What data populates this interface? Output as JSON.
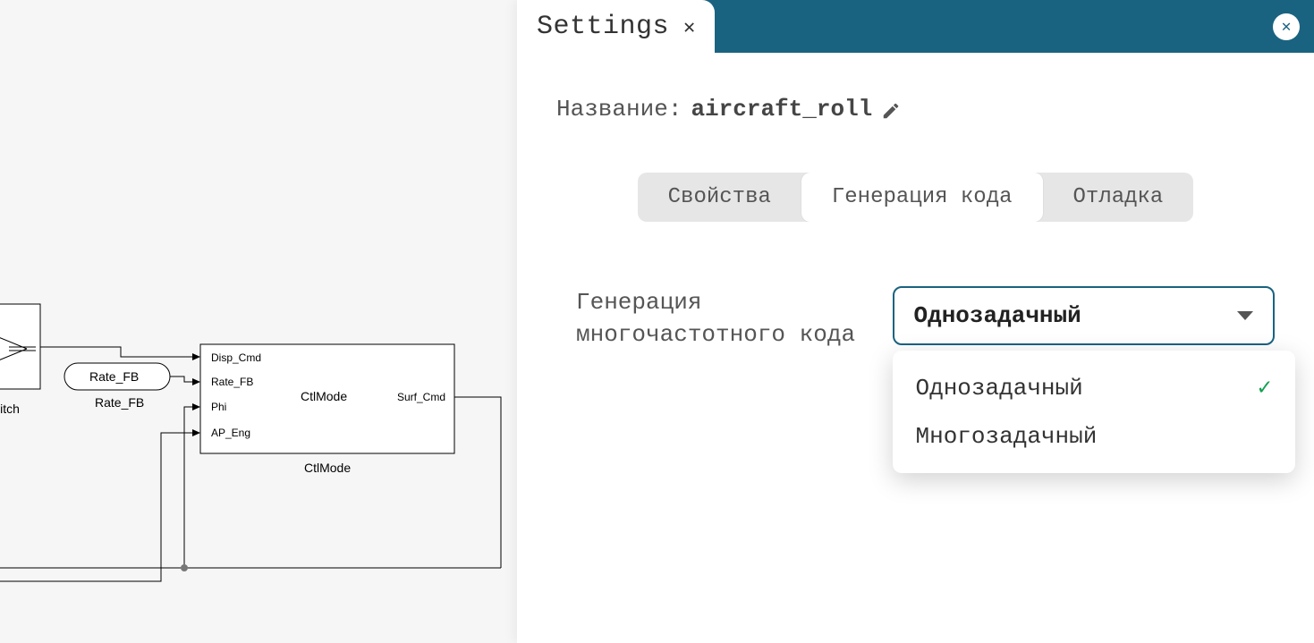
{
  "panel": {
    "title": "Settings",
    "name_label": "Название:",
    "name_value": "aircraft_roll",
    "tabs": [
      {
        "label": "Свойства",
        "active": false
      },
      {
        "label": "Генерация кода",
        "active": true
      },
      {
        "label": "Отладка",
        "active": false
      }
    ],
    "field": {
      "label_lines": [
        "Генерация",
        "многочастотного кода"
      ],
      "selected": "Однозадачный",
      "options": [
        {
          "label": "Однозадачный",
          "selected": true
        },
        {
          "label": "Многозадачный",
          "selected": false
        }
      ]
    }
  },
  "diagram": {
    "switch_block": {
      "name": "witch"
    },
    "rate_fb_source": {
      "label": "Rate_FB",
      "caption": "Rate_FB"
    },
    "ctlmode_block": {
      "name": "CtlMode",
      "caption": "CtlMode",
      "inputs": [
        "Disp_Cmd",
        "Rate_FB",
        "Phi",
        "AP_Eng"
      ],
      "outputs": [
        "Surf_Cmd"
      ]
    }
  }
}
